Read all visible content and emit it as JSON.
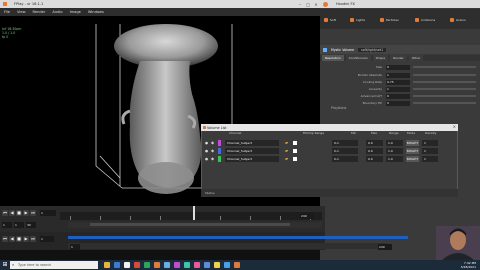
{
  "main_window": {
    "title": "FPlay - vr 16.1.1",
    "menu": [
      "File",
      "View",
      "Render",
      "Audio",
      "Image",
      "Windows"
    ],
    "stats": [
      "Inf 16:30pm",
      "1.0 / 1.0",
      "fp 0"
    ]
  },
  "right_panel": {
    "title": "Houdini FX",
    "tools": [
      "Soft",
      "Lights",
      "Particles",
      "Collisions",
      "Grains"
    ],
    "node_name": "Mystic Volume",
    "node_path": "soft/light/set1",
    "tabs": [
      "Resolution",
      "Conditioners",
      "Shape",
      "Render",
      "Other"
    ],
    "rows": [
      {
        "label": "Size",
        "value": "0"
      },
      {
        "label": "Border Absolute",
        "value": "1"
      },
      {
        "label": "Cooling Rate",
        "value": "0.75"
      },
      {
        "label": "Linearity",
        "value": "1"
      },
      {
        "label": "Advanced LUT",
        "value": "0"
      },
      {
        "label": "Boundary Fill",
        "value": "0"
      }
    ],
    "side_label": "Playblast"
  },
  "dialog": {
    "title": "Volume List",
    "headers": [
      "Channel",
      "Fill/Clip Range",
      "Min",
      "Max",
      "Range",
      "Mode",
      "Density"
    ],
    "channels": [
      {
        "name": "Channel_Subject",
        "color": "#c24bd6",
        "range": "0-1",
        "min": "0.0",
        "max": "1.0",
        "mode": "BRIGHT",
        "density": "1"
      },
      {
        "name": "Channel_Subject",
        "color": "#4a68d8",
        "range": "0-1",
        "min": "0.0",
        "max": "1.0",
        "mode": "BRIGHT",
        "density": "1"
      },
      {
        "name": "Channel_Subject",
        "color": "#3fbf58",
        "range": "0-1",
        "min": "0.0",
        "max": "1.0",
        "mode": "BRIGHT",
        "density": "1"
      }
    ],
    "footer": "Status"
  },
  "timeline": {
    "frame": "1",
    "frame_end": "240",
    "start_field": "1",
    "end_field": "1",
    "fps_field": "30",
    "range_start": "1",
    "range_end": "240",
    "counter": "1"
  },
  "taskbar": {
    "search_placeholder": "Type here to search",
    "time": "7:42 PM",
    "date": "3/28/2021",
    "icon_colors": [
      "#e8b43a",
      "#3a7bd5",
      "#f2f2f2",
      "#d84a3a",
      "#2fa35a",
      "#e27b3a",
      "#6ab0de",
      "#c14cd1",
      "#3ac7a8",
      "#e85a9c",
      "#5f8bd8",
      "#f0d14a",
      "#4a9fe8",
      "#e07a3a"
    ]
  }
}
